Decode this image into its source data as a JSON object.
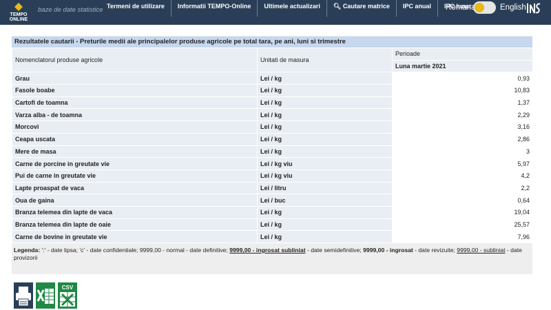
{
  "header": {
    "logo_text": "TEMPO ONLINE",
    "tagline": "baze de date statistice",
    "nav": [
      "Termeni de utilizare",
      "Informatii TEMPO-Online",
      "Ultimele actualizari",
      "Cautare matrice",
      "IPC anual",
      "IPC lunar"
    ],
    "lang_ro": "Romana",
    "lang_en": "English",
    "ins_logo": "INS"
  },
  "results": {
    "title": "Rezultatele cautarii - Preturile medii ale principalelor produse agricole pe total tara, pe ani, luni si trimestre",
    "col_product": "Nomenclatorul produse agricole",
    "col_unit": "Unitati de masura",
    "col_period": "Perioade",
    "period": "Luna martie 2021",
    "rows": [
      {
        "name": "Grau",
        "unit": "Lei / kg",
        "value": "0,93"
      },
      {
        "name": "Fasole boabe",
        "unit": "Lei / kg",
        "value": "10,83"
      },
      {
        "name": "Cartofi de toamna",
        "unit": "Lei / kg",
        "value": "1,37"
      },
      {
        "name": "Varza alba - de toamna",
        "unit": "Lei / kg",
        "value": "2,29"
      },
      {
        "name": "Morcovi",
        "unit": "Lei / kg",
        "value": "3,16"
      },
      {
        "name": "Ceapa uscata",
        "unit": "Lei / kg",
        "value": "2,86"
      },
      {
        "name": "Mere de masa",
        "unit": "Lei / kg",
        "value": "3"
      },
      {
        "name": "Carne de porcine in greutate vie",
        "unit": "Lei / kg viu",
        "value": "5,97"
      },
      {
        "name": "Pui de carne in greutate vie",
        "unit": "Lei / kg viu",
        "value": "4,2"
      },
      {
        "name": "Lapte proaspat de vaca",
        "unit": "Lei / litru",
        "value": "2,2"
      },
      {
        "name": "Oua de gaina",
        "unit": "Lei / buc",
        "value": "0,64"
      },
      {
        "name": "Branza telemea din lapte de vaca",
        "unit": "Lei / kg",
        "value": "19,04"
      },
      {
        "name": "Branza telemea din lapte de oaie",
        "unit": "Lei / kg",
        "value": "25,57"
      },
      {
        "name": "Carne de bovine in greutate vie",
        "unit": "Lei / kg",
        "value": "7,96"
      }
    ]
  },
  "legend": {
    "label": "Legenda:",
    "part1": " ':' - date lipsa; 'c' - date confidentiale; 9999,00 - normal - date definitive; ",
    "ex1": "9999,00 - ingrosat subliniat",
    "part2": " - date semidefinitive; ",
    "ex2": "9999,00 - ingrosat",
    "part3": " - date revizuite; ",
    "ex3": "9999,00 - subliniat",
    "part4": " - date provizorii"
  },
  "exports": {
    "csv_label": "CSV"
  },
  "colors": {
    "header_bg": "#2a3f57",
    "title_bg": "#c6d7ee",
    "toggle_knob": "#e8b81e",
    "excel_green": "#1e8a45",
    "print_blue": "#2a3f57"
  }
}
